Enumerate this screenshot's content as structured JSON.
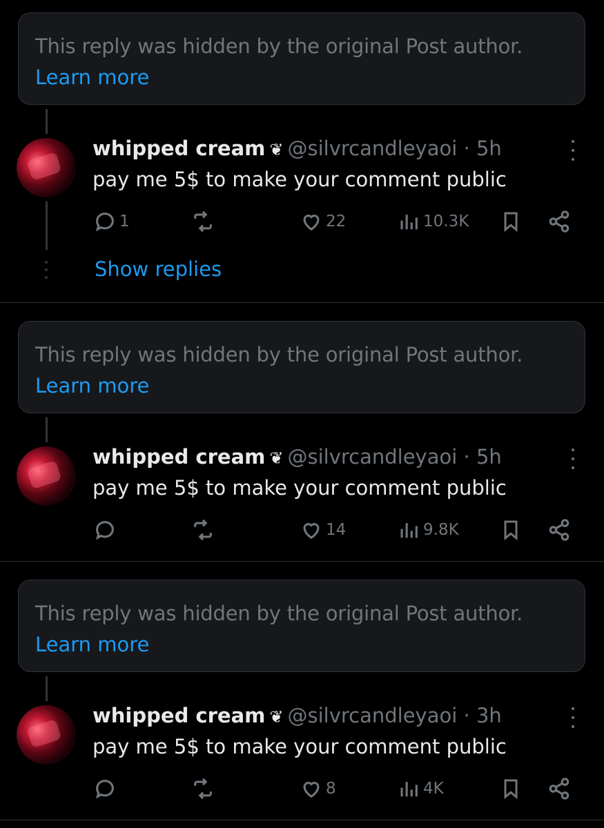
{
  "posts": [
    {
      "hidden_notice": "This reply was hidden by the original Post author.",
      "learn_more": "Learn more",
      "name": "whipped cream",
      "badge": "❦",
      "handle": "@silvrcandleyaoi",
      "time": "· 5h",
      "text": "pay me 5$ to make your comment public",
      "replies": "1",
      "likes": "22",
      "views": "10.3K",
      "show_replies": "Show replies"
    },
    {
      "hidden_notice": "This reply was hidden by the original Post author.",
      "learn_more": "Learn more",
      "name": "whipped cream",
      "badge": "❦",
      "handle": "@silvrcandleyaoi",
      "time": "· 5h",
      "text": "pay me 5$ to make your comment public",
      "replies": "",
      "likes": "14",
      "views": "9.8K"
    },
    {
      "hidden_notice": "This reply was hidden by the original Post author.",
      "learn_more": "Learn more",
      "name": "whipped cream",
      "badge": "❦",
      "handle": "@silvrcandleyaoi",
      "time": "· 3h",
      "text": "pay me 5$ to make your comment public",
      "replies": "",
      "likes": "8",
      "views": "4K"
    }
  ],
  "colors": {
    "background": "#000000",
    "card": "#16181c",
    "border": "#2f3336",
    "muted": "#71767b",
    "link": "#1d9bf0",
    "text": "#e7e9ea"
  }
}
